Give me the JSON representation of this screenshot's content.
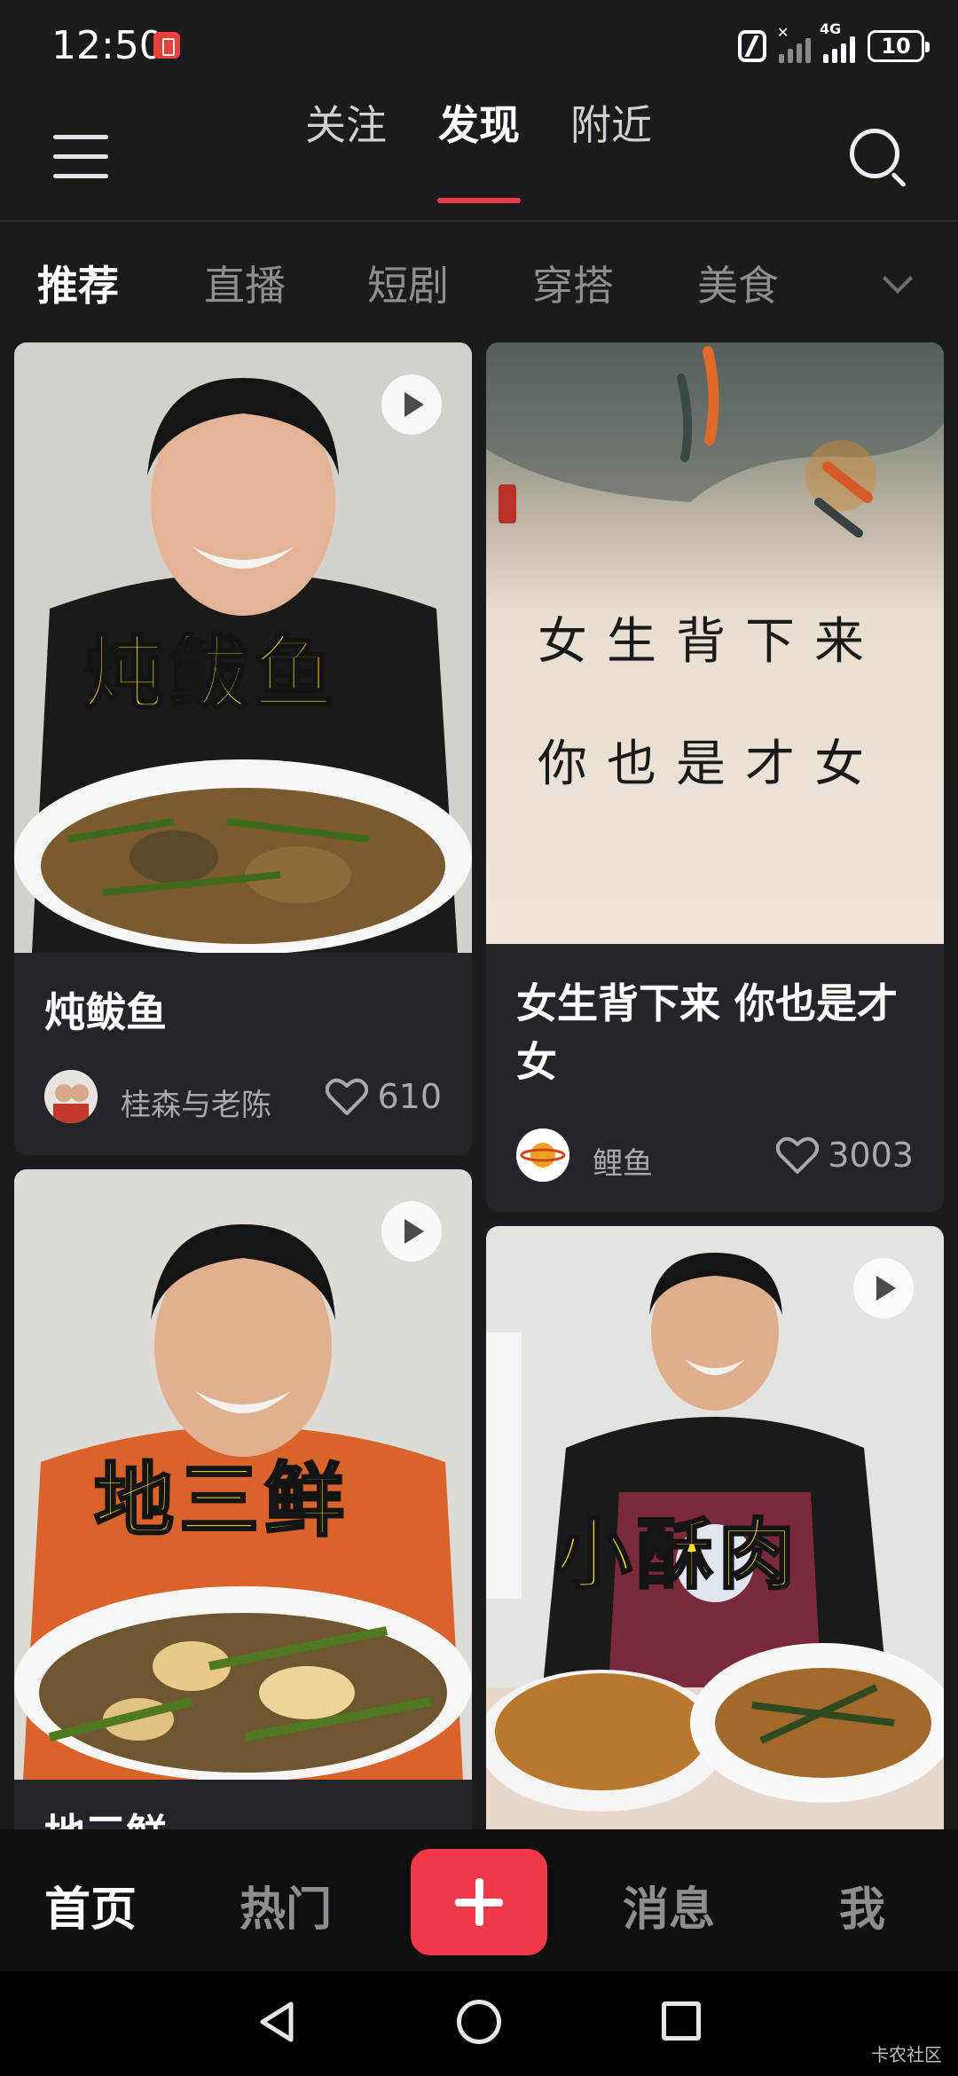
{
  "status_bar": {
    "time": "12:50",
    "network": "4G",
    "battery": "10"
  },
  "top_nav": {
    "tabs": [
      "关注",
      "发现",
      "附近"
    ],
    "active_tab": "发现"
  },
  "categories": {
    "items": [
      "推荐",
      "直播",
      "短剧",
      "穿搭",
      "美食"
    ],
    "active": "推荐"
  },
  "feed": {
    "cards": [
      {
        "title": "炖鲅鱼",
        "overlay": "炖鲅鱼",
        "author": "桂森与老陈",
        "likes": "610",
        "video": true
      },
      {
        "title": "女生背下来 你也是才女",
        "overlay_line1": "女生背下来",
        "overlay_line2": "你也是才女",
        "author": "鲤鱼",
        "likes": "3003",
        "video": false
      },
      {
        "title": "地三鲜",
        "overlay": "地三鲜",
        "video": true
      },
      {
        "overlay": "小酥肉",
        "video": true
      }
    ]
  },
  "bottom_nav": {
    "items": [
      "首页",
      "热门",
      "消息",
      "我"
    ],
    "active": "首页"
  },
  "watermark": "卡农社区",
  "colors": {
    "accent": "#f03a4a",
    "background": "#1b1a1f",
    "card": "#25242a",
    "overlay_text": "#ffe21c"
  },
  "icons": [
    "menu-icon",
    "search-icon",
    "play-icon",
    "heart-icon",
    "plus-icon",
    "back-icon",
    "home-icon",
    "recent-apps-icon",
    "nfc-icon",
    "signal-icon",
    "battery-icon",
    "chevron-down-icon"
  ]
}
